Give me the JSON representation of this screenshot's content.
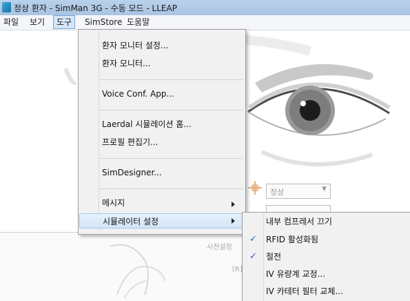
{
  "window": {
    "title": "정상 환자 - SimMan 3G - 수동 모드 - LLEAP"
  },
  "menubar": {
    "items": [
      "파일",
      "보기",
      "도구",
      "SimStore",
      "도움말"
    ],
    "active": "도구"
  },
  "tools_menu": {
    "items": [
      "환자 모니터 설정...",
      "환자 모니터...",
      "Voice Conf. App...",
      "Laerdal 시뮬레이션 홈...",
      "프로필 편집기...",
      "SimDesigner...",
      "메시지",
      "시뮬레이터 설정"
    ],
    "highlighted": "시뮬레이터 설정"
  },
  "simulator_submenu": {
    "items": [
      "내부 컴프레서 끄기",
      "RFID 활성화됨",
      "절전",
      "IV 유량계 교정...",
      "IV 카테터 필터 교체..."
    ],
    "checked": [
      "RFID 활성화됨",
      "절전"
    ]
  },
  "background": {
    "state_dropdown": "정상",
    "preset_label": "사전설정",
    "r_label": "[R]"
  },
  "icons": [
    "app-icon",
    "check-icon",
    "submenu-arrow-icon",
    "eye-illustration",
    "airway-illustration"
  ]
}
